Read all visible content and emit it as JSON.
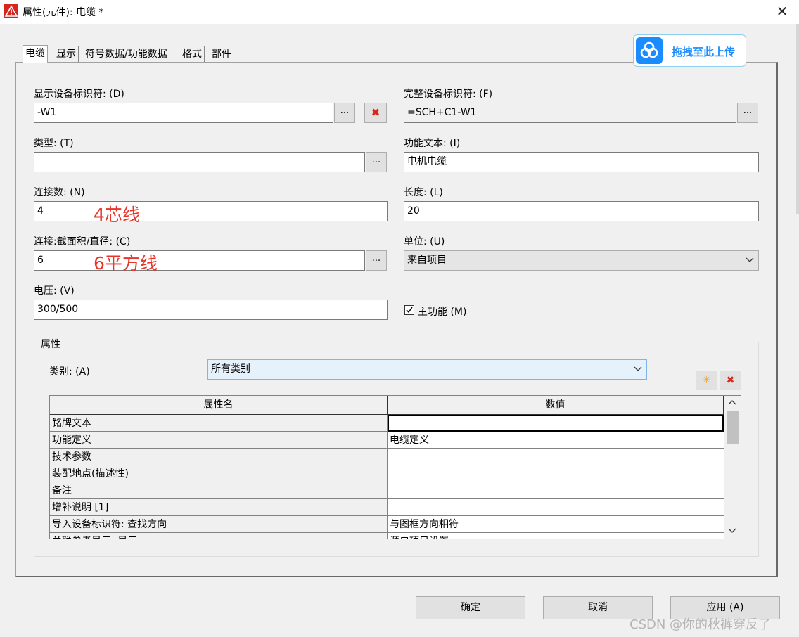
{
  "window": {
    "title": "属性(元件): 电缆 *",
    "close_glyph": "✕"
  },
  "tabs": [
    "电缆",
    "显示",
    "符号数据/功能数据",
    "格式",
    "部件"
  ],
  "upload_badge": {
    "text": "拖拽至此上传"
  },
  "fields": {
    "display_id_label": "显示设备标识符: (D)",
    "display_id_value": "-W1",
    "full_id_label": "完整设备标识符: (F)",
    "full_id_value": "=SCH+C1-W1",
    "type_label": "类型: (T)",
    "type_value": "",
    "func_text_label": "功能文本: (I)",
    "func_text_value": "电机电缆",
    "conn_count_label": "连接数: (N)",
    "conn_count_value": "4",
    "conn_count_note": "4芯线",
    "length_label": "长度: (L)",
    "length_value": "20",
    "cross_label": "连接:截面积/直径: (C)",
    "cross_value": "6",
    "cross_note": "6平方线",
    "unit_label": "单位: (U)",
    "unit_value": "来自项目",
    "voltage_label": "电压: (V)",
    "voltage_value": "300/500",
    "main_func_label": "主功能 (M)",
    "main_func_checked": true
  },
  "buttons": {
    "dots": "...",
    "delete": "✖",
    "new": "✳"
  },
  "properties": {
    "group_title": "属性",
    "category_label": "类别: (A)",
    "category_value": "所有类别",
    "col_name": "属性名",
    "col_value": "数值",
    "rows": [
      {
        "name": "铭牌文本",
        "value": ""
      },
      {
        "name": "功能定义",
        "value": "电缆定义"
      },
      {
        "name": "技术参数",
        "value": ""
      },
      {
        "name": "装配地点(描述性)",
        "value": ""
      },
      {
        "name": "备注",
        "value": ""
      },
      {
        "name": "增补说明 [1]",
        "value": ""
      },
      {
        "name": "导入设备标识符: 查找方向",
        "value": "与图框方向相符"
      },
      {
        "name": "关联参考显示: 显示",
        "value": "源自项目设置"
      }
    ]
  },
  "footer": {
    "ok": "确定",
    "cancel": "取消",
    "apply": "应用 (A)"
  },
  "watermark": "CSDN @你的秋裤穿反了"
}
